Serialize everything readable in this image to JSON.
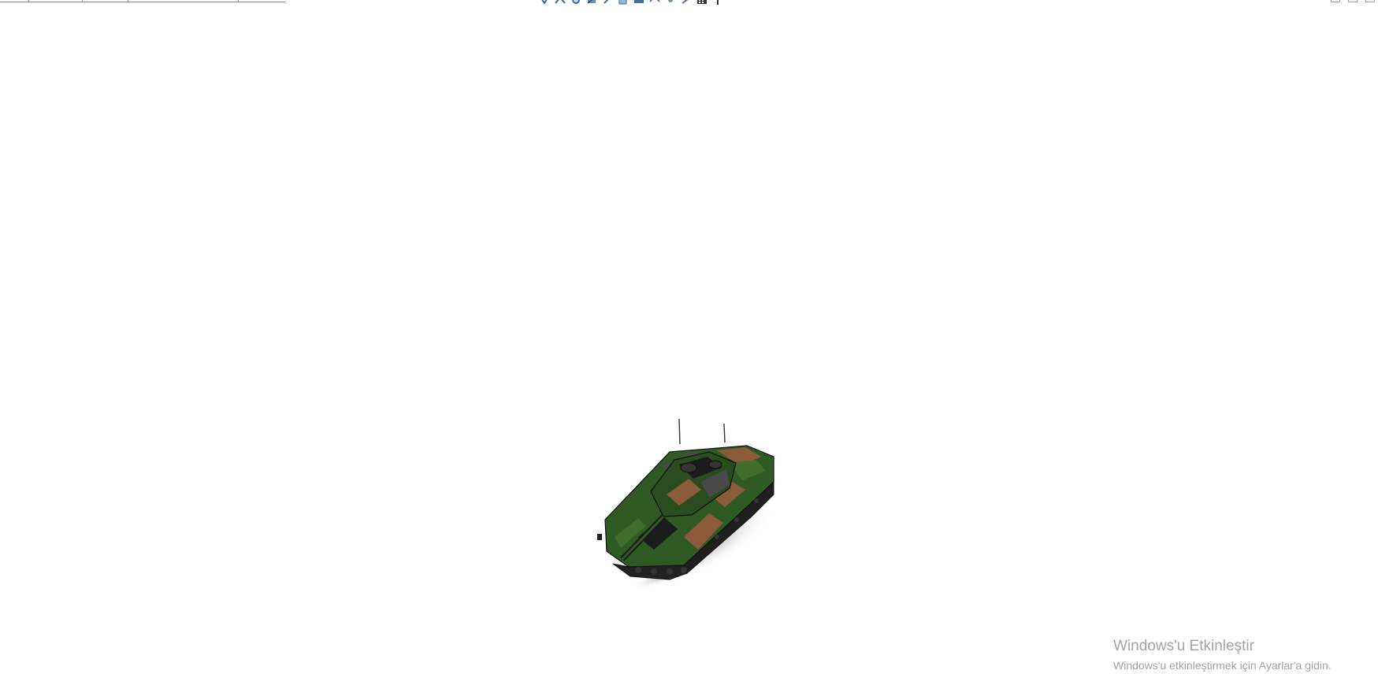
{
  "toolbar": {
    "icons": [
      "zoom-to-fit-icon",
      "zoom-to-area-icon",
      "previous-view-icon",
      "section-view-icon",
      "dynamic-annotation-icon",
      "view-orientation-icon",
      "display-style-icon",
      "hide-show-items-icon",
      "edit-appearance-icon",
      "apply-scene-icon",
      "view-settings-icon",
      "pin-icon"
    ]
  },
  "model": {
    "name": "tank",
    "colors": {
      "dark_green": "#2f5a23",
      "green": "#3f6e2c",
      "brown": "#8a5a3a",
      "black": "#1c1c1c",
      "grey": "#4a4a4a"
    }
  },
  "watermark": {
    "title": "Windows'u Etkinleştir",
    "subtitle": "Windows'u etkinleştirmek için Ayarlar'a gidin."
  }
}
